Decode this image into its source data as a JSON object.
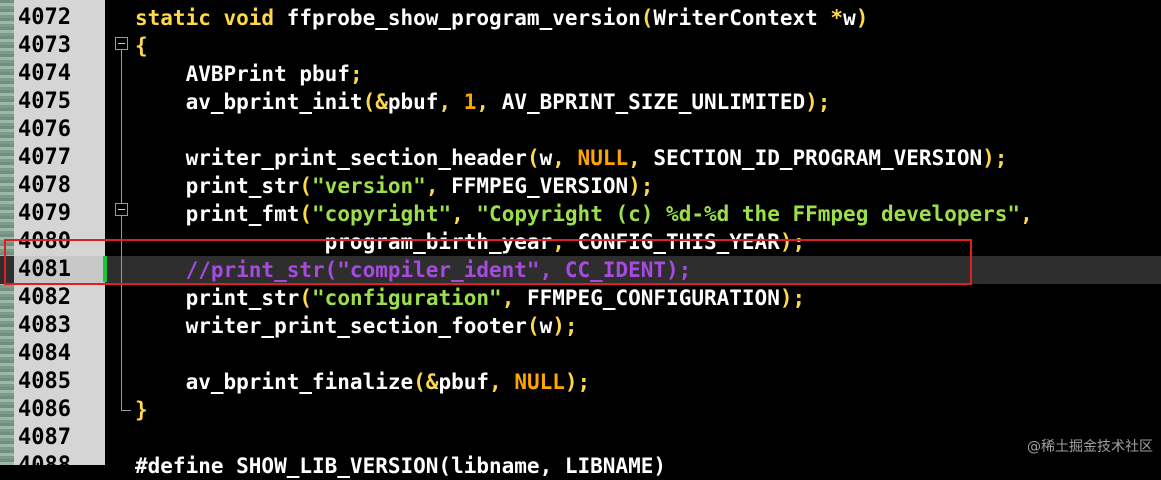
{
  "editor": {
    "lines": [
      {
        "number": "4072",
        "segments": [
          {
            "text": "static void ",
            "class": "kw"
          },
          {
            "text": "ffprobe_show_program_version",
            "class": ""
          },
          {
            "text": "(",
            "class": "paren"
          },
          {
            "text": "WriterContext ",
            "class": ""
          },
          {
            "text": "*",
            "class": "kw"
          },
          {
            "text": "w",
            "class": ""
          },
          {
            "text": ")",
            "class": "paren"
          }
        ]
      },
      {
        "number": "4073",
        "segments": [
          {
            "text": "{",
            "class": "paren"
          }
        ]
      },
      {
        "number": "4074",
        "segments": [
          {
            "text": "    AVBPrint pbuf",
            "class": ""
          },
          {
            "text": ";",
            "class": "kw"
          }
        ]
      },
      {
        "number": "4075",
        "segments": [
          {
            "text": "    av_bprint_init",
            "class": ""
          },
          {
            "text": "(&",
            "class": "paren"
          },
          {
            "text": "pbuf",
            "class": ""
          },
          {
            "text": ", ",
            "class": "kw"
          },
          {
            "text": "1",
            "class": "num"
          },
          {
            "text": ", ",
            "class": "kw"
          },
          {
            "text": "AV_BPRINT_SIZE_UNLIMITED",
            "class": ""
          },
          {
            "text": ");",
            "class": "paren"
          }
        ]
      },
      {
        "number": "4076",
        "segments": []
      },
      {
        "number": "4077",
        "segments": [
          {
            "text": "    writer_print_section_header",
            "class": ""
          },
          {
            "text": "(",
            "class": "paren"
          },
          {
            "text": "w",
            "class": ""
          },
          {
            "text": ", ",
            "class": "kw"
          },
          {
            "text": "NULL",
            "class": "num"
          },
          {
            "text": ", ",
            "class": "kw"
          },
          {
            "text": "SECTION_ID_PROGRAM_VERSION",
            "class": ""
          },
          {
            "text": ");",
            "class": "paren"
          }
        ]
      },
      {
        "number": "4078",
        "segments": [
          {
            "text": "    print_str",
            "class": ""
          },
          {
            "text": "(",
            "class": "paren"
          },
          {
            "text": "\"version\"",
            "class": "str"
          },
          {
            "text": ", ",
            "class": "kw"
          },
          {
            "text": "FFMPEG_VERSION",
            "class": ""
          },
          {
            "text": ");",
            "class": "paren"
          }
        ]
      },
      {
        "number": "4079",
        "segments": [
          {
            "text": "    print_fmt",
            "class": ""
          },
          {
            "text": "(",
            "class": "paren"
          },
          {
            "text": "\"copyright\"",
            "class": "str"
          },
          {
            "text": ", ",
            "class": "kw"
          },
          {
            "text": "\"Copyright (c) %d-%d the FFmpeg developers\"",
            "class": "str"
          },
          {
            "text": ",",
            "class": "kw"
          }
        ]
      },
      {
        "number": "4080",
        "segments": [
          {
            "text": "               program_birth_year",
            "class": ""
          },
          {
            "text": ", ",
            "class": "kw"
          },
          {
            "text": "CONFIG_THIS_YEAR",
            "class": ""
          },
          {
            "text": ");",
            "class": "paren"
          }
        ]
      },
      {
        "number": "4081",
        "segments": [
          {
            "text": "    //print_str(\"compiler_ident\", CC_IDENT);",
            "class": "cmt"
          }
        ]
      },
      {
        "number": "4082",
        "segments": [
          {
            "text": "    print_str",
            "class": ""
          },
          {
            "text": "(",
            "class": "paren"
          },
          {
            "text": "\"configuration\"",
            "class": "str"
          },
          {
            "text": ", ",
            "class": "kw"
          },
          {
            "text": "FFMPEG_CONFIGURATION",
            "class": ""
          },
          {
            "text": ");",
            "class": "paren"
          }
        ]
      },
      {
        "number": "4083",
        "segments": [
          {
            "text": "    writer_print_section_footer",
            "class": ""
          },
          {
            "text": "(",
            "class": "paren"
          },
          {
            "text": "w",
            "class": ""
          },
          {
            "text": ");",
            "class": "paren"
          }
        ]
      },
      {
        "number": "4084",
        "segments": []
      },
      {
        "number": "4085",
        "segments": [
          {
            "text": "    av_bprint_finalize",
            "class": ""
          },
          {
            "text": "(&",
            "class": "paren"
          },
          {
            "text": "pbuf",
            "class": ""
          },
          {
            "text": ", ",
            "class": "kw"
          },
          {
            "text": "NULL",
            "class": "num"
          },
          {
            "text": ");",
            "class": "paren"
          }
        ]
      },
      {
        "number": "4086",
        "segments": [
          {
            "text": "}",
            "class": "paren"
          }
        ]
      },
      {
        "number": "4087",
        "segments": []
      },
      {
        "number": "4088",
        "segments": [
          {
            "text": "#define SHOW_LIB_VERSION(libname, LIBNAME)",
            "class": ""
          }
        ]
      }
    ],
    "current_line": "4081"
  },
  "watermark": "@稀土掘金技术社区"
}
